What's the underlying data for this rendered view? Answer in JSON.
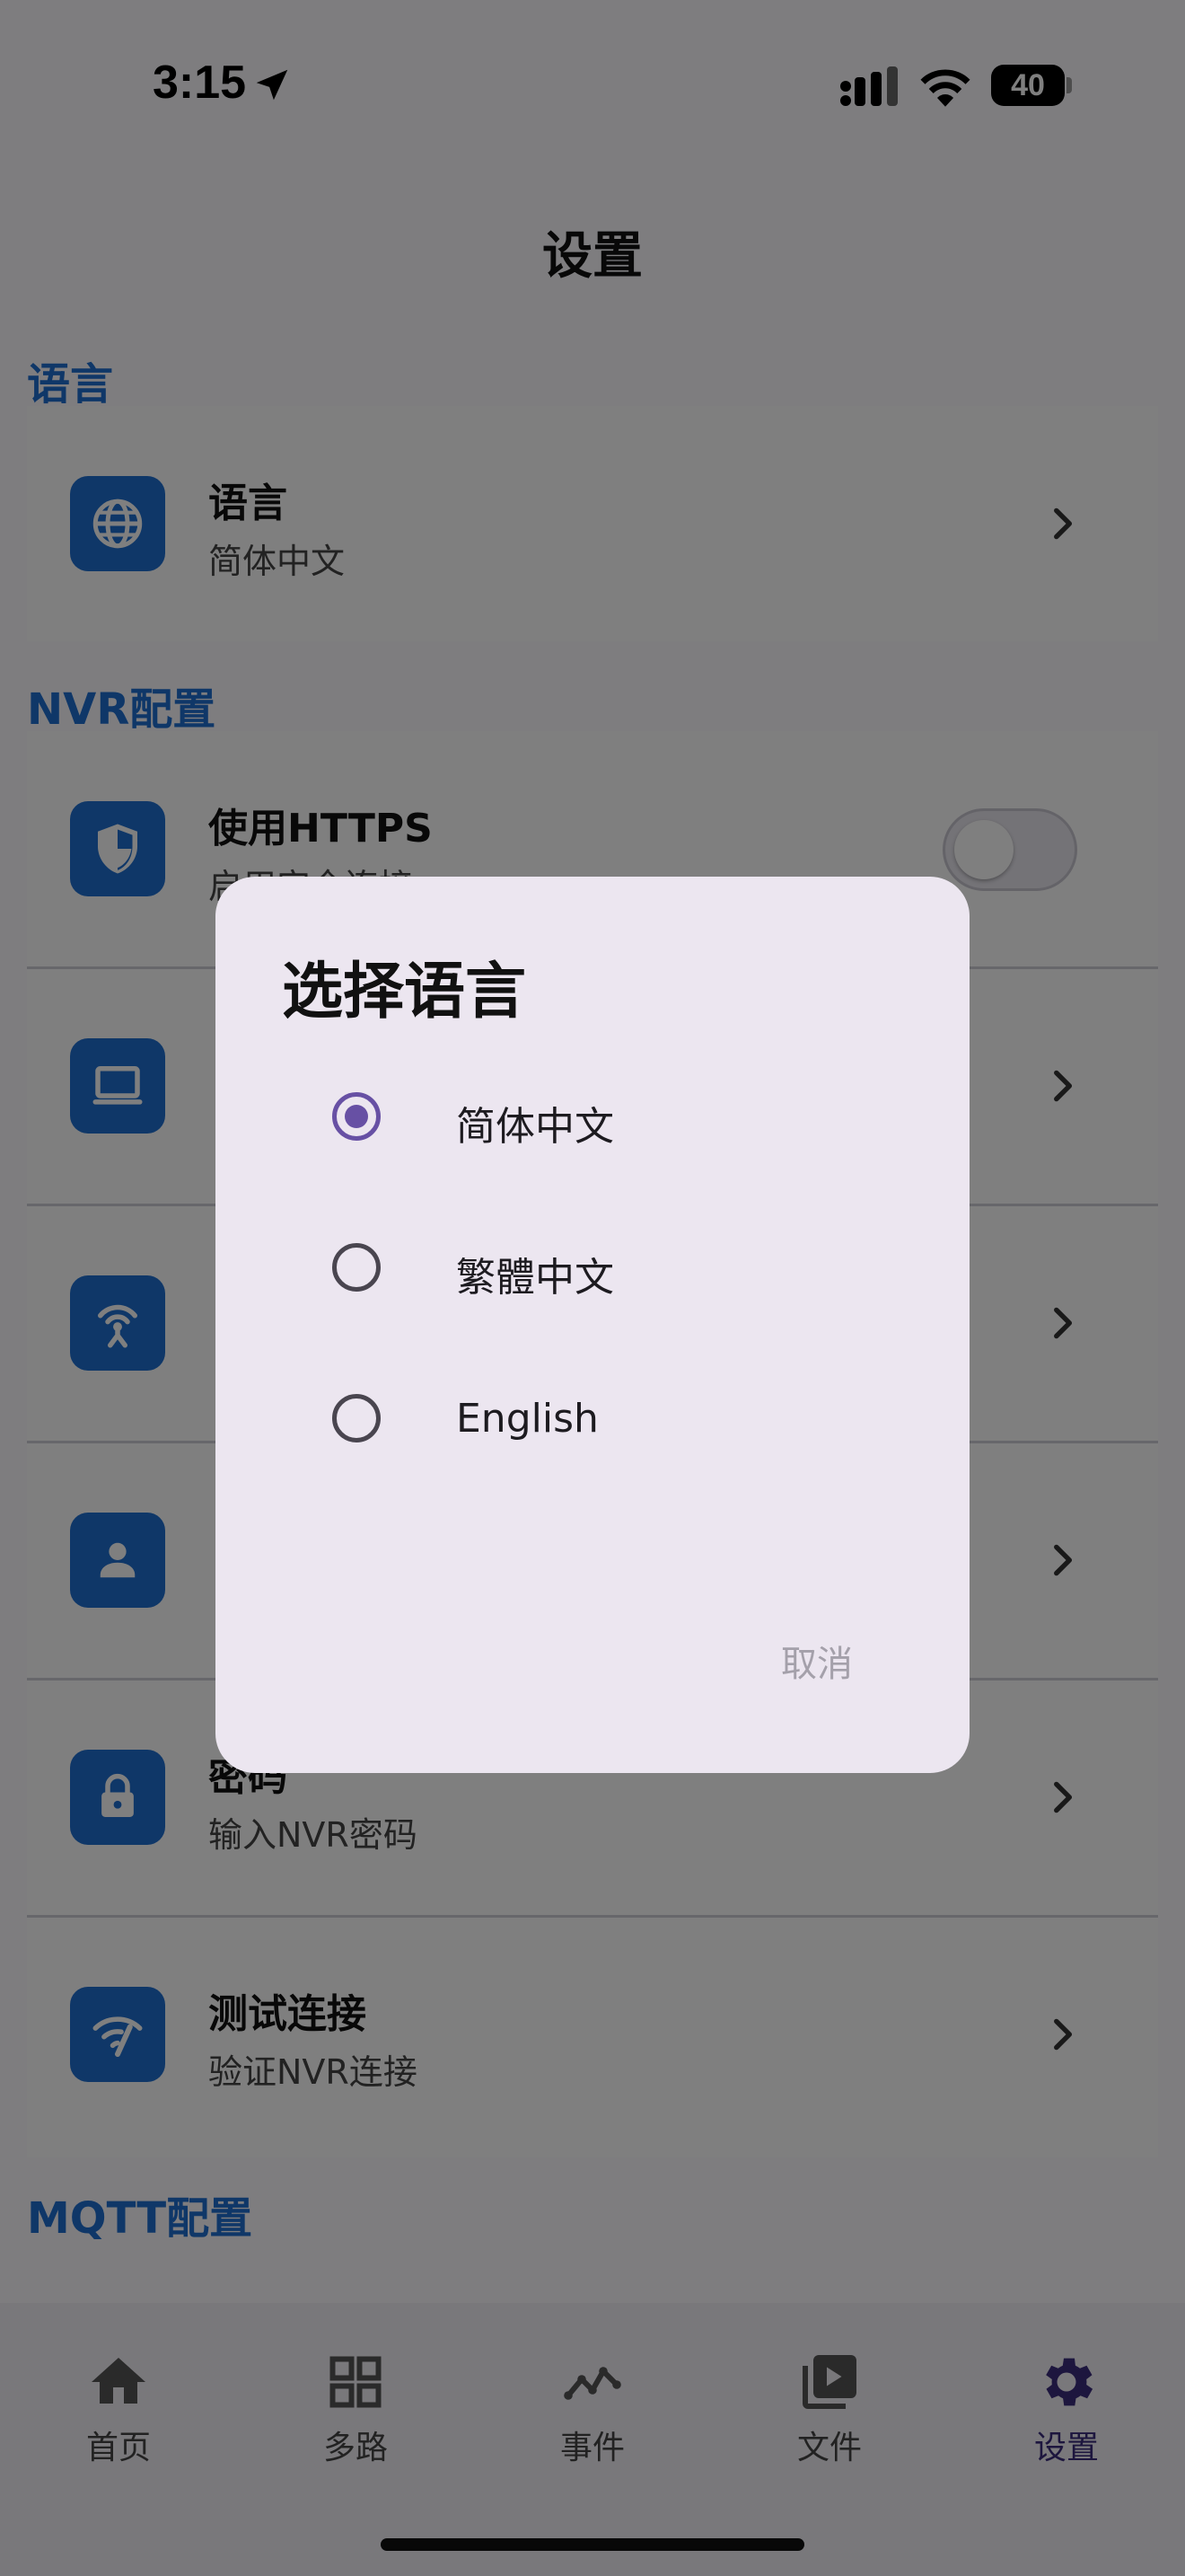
{
  "status": {
    "time": "3:15",
    "battery": "40"
  },
  "header": {
    "title": "设置"
  },
  "sections": {
    "language": {
      "title": "语言"
    },
    "nvr": {
      "title": "NVR配置"
    },
    "mqtt": {
      "title": "MQTT配置"
    }
  },
  "items": {
    "language": {
      "title": "语言",
      "subtitle": "简体中文"
    },
    "https": {
      "title": "使用HTTPS",
      "subtitle": "启用安全连接",
      "enabled": false
    },
    "password": {
      "title": "密码",
      "subtitle": "输入NVR密码"
    },
    "test": {
      "title": "测试连接",
      "subtitle": "验证NVR连接"
    }
  },
  "dialog": {
    "title": "选择语言",
    "options": [
      "简体中文",
      "繁體中文",
      "English"
    ],
    "selected": "简体中文",
    "cancel": "取消"
  },
  "tabs": [
    {
      "label": "首页",
      "icon": "home-icon"
    },
    {
      "label": "多路",
      "icon": "grid-icon"
    },
    {
      "label": "事件",
      "icon": "trend-icon"
    },
    {
      "label": "文件",
      "icon": "video-library-icon"
    },
    {
      "label": "设置",
      "icon": "gear-icon",
      "active": true
    }
  ],
  "colors": {
    "accent": "#1f6fd1",
    "dialog_bg": "#ece6f0",
    "radio_selected": "#6750a4",
    "active_tab": "#3a2c7d"
  }
}
